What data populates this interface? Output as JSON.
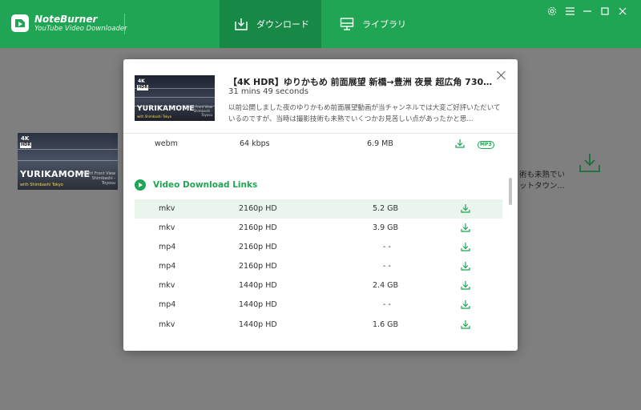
{
  "app": {
    "name": "NoteBurner",
    "subtitle": "YouTube Video Downloader"
  },
  "nav": {
    "tabs": [
      {
        "label": "ダウンロード",
        "icon": "download-tray-icon",
        "active": true
      },
      {
        "label": "ライブラリ",
        "icon": "monitor-icon",
        "active": false
      }
    ]
  },
  "window_controls": [
    "settings-gear-icon",
    "menu-icon",
    "minimize-icon",
    "maximize-icon",
    "close-icon"
  ],
  "background": {
    "text_lines": [
      "術も未熟でい",
      "ットタウン..."
    ]
  },
  "thumbnail": {
    "badge_4k": "4K",
    "badge_hdr": "HDR",
    "title": "YURIKAMOME",
    "subtitle": "with Shimbashi Tokyo",
    "side_text": "Night Front View Shimbashi - Toyosu"
  },
  "video": {
    "title": "【4K HDR】ゆりかもめ 前面展望 新橋→豊洲 夜景 超広角 7300系 20...",
    "duration": "31 mins 49 seconds",
    "description": "以前公開しました夜のゆりかもめ前面展望動画が当チャンネルでは大変ご好評いただいているのですが、当時は撮影技術も未熟でいくつかお見苦しい点があったかと思..."
  },
  "audio_row": {
    "format": "webm",
    "quality": "64 kbps",
    "size": "6.9 MB",
    "mp3_label": "MP3"
  },
  "video_section": {
    "title": "Video Download Links",
    "rows": [
      {
        "format": "mkv",
        "quality": "2160p HD",
        "size": "5.2 GB"
      },
      {
        "format": "mkv",
        "quality": "2160p HD",
        "size": "3.9 GB"
      },
      {
        "format": "mp4",
        "quality": "2160p HD",
        "size": "- -"
      },
      {
        "format": "mp4",
        "quality": "2160p HD",
        "size": "- -"
      },
      {
        "format": "mkv",
        "quality": "1440p HD",
        "size": "2.4 GB"
      },
      {
        "format": "mp4",
        "quality": "1440p HD",
        "size": "- -"
      },
      {
        "format": "mkv",
        "quality": "1440p HD",
        "size": "1.6 GB"
      }
    ]
  },
  "colors": {
    "brand_green": "#1fa553",
    "active_tab": "#178845",
    "row_highlight": "#e9f5ed",
    "overlay_gray": "#7f7f7f"
  }
}
